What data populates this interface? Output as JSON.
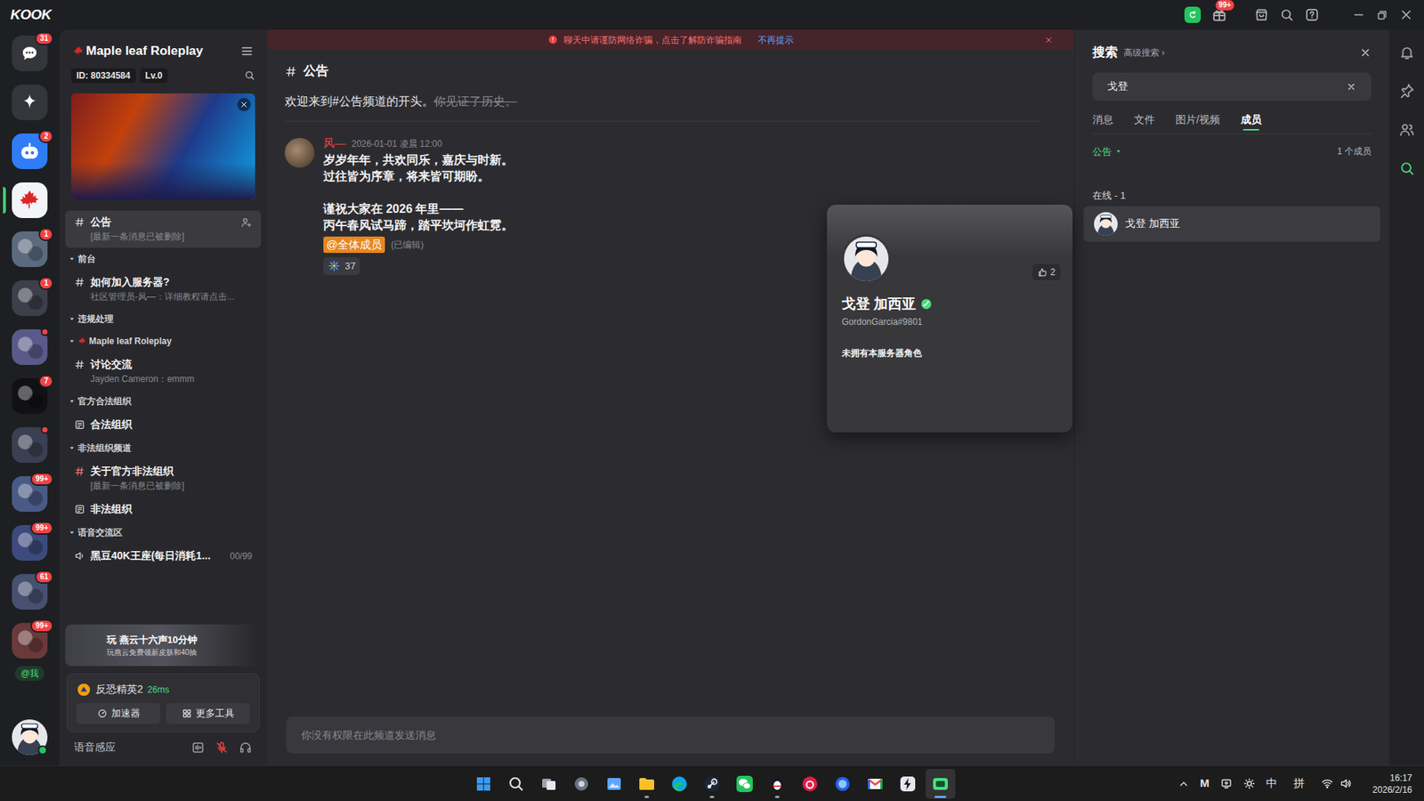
{
  "title_bar": {
    "logo": "KOOK",
    "notification_badge": "99+"
  },
  "server_rail": {
    "items": [
      {
        "kind": "dm",
        "badge": "31",
        "dot": false,
        "selected": false,
        "color": "#35363b"
      },
      {
        "kind": "ai",
        "dot": false,
        "selected": false,
        "color": "#35363b"
      },
      {
        "kind": "bot",
        "badge": "2",
        "dot": false,
        "selected": false,
        "color": "#2f7cf6"
      },
      {
        "kind": "maple",
        "dot": false,
        "selected": true,
        "color": "#f3f4f6"
      },
      {
        "kind": "server",
        "badge": "1",
        "dot": false,
        "selected": false,
        "color": "#5b6b7d"
      },
      {
        "kind": "server",
        "badge": "1",
        "dot": false,
        "selected": false,
        "color": "#3d3f4a"
      },
      {
        "kind": "server",
        "dot": true,
        "selected": false,
        "color": "#5a5a8a"
      },
      {
        "kind": "server",
        "badge": "7",
        "dot": false,
        "selected": false,
        "color": "#111114"
      },
      {
        "kind": "server",
        "dot": true,
        "selected": false,
        "color": "#3b3f52"
      },
      {
        "kind": "server",
        "badge": "99+",
        "dot": false,
        "selected": false,
        "color": "#4a5a86"
      },
      {
        "kind": "server",
        "badge": "99+",
        "dot": false,
        "selected": false,
        "color": "#3d4a7c"
      },
      {
        "kind": "server",
        "badge": "61",
        "dot": false,
        "selected": false,
        "color": "#465070"
      },
      {
        "kind": "server",
        "badge": "99+",
        "dot": false,
        "selected": false,
        "color": "#6a3a3a"
      }
    ],
    "mention": "@我",
    "user": {
      "online": true
    }
  },
  "channel_sidebar": {
    "server_name": "Maple leaf Roleplay",
    "server_id": "ID: 80334584",
    "level": "Lv.0",
    "channels": [
      {
        "kind": "text",
        "name": "公告",
        "subtitle": "[最新一条消息已被删除]",
        "selected": true
      },
      {
        "kind": "category",
        "name": "前台",
        "expanded": true
      },
      {
        "kind": "text",
        "name": "如何加入服务器?",
        "subtitle": "社区管理员-风—：详细教程请点击...",
        "selected": false
      },
      {
        "kind": "category",
        "name": "违规处理",
        "expanded": true
      },
      {
        "kind": "category-leaf",
        "name": "Maple leaf Roleplay",
        "expanded": true
      },
      {
        "kind": "text",
        "name": "讨论交流",
        "subtitle": "Jayden Cameron：emmm",
        "selected": false
      },
      {
        "kind": "category",
        "name": "官方合法组织",
        "expanded": true
      },
      {
        "kind": "board",
        "name": "合法组织",
        "selected": false
      },
      {
        "kind": "category",
        "name": "非法组织频道",
        "expanded": true
      },
      {
        "kind": "restricted",
        "name": "关于官方非法组织",
        "subtitle": "[最新一条消息已被删除]",
        "selected": false
      },
      {
        "kind": "board",
        "name": "非法组织",
        "selected": false
      },
      {
        "kind": "category",
        "name": "语音交流区",
        "expanded": true
      },
      {
        "kind": "voice",
        "name": "黑豆40K王座(每日消耗1...",
        "count": "00/99",
        "selected": false
      }
    ],
    "ad": {
      "title": "玩 燕云十六声10分钟",
      "subtitle": "玩燕云免费领新皮肤和40抽"
    },
    "footer": {
      "game": "反恐精英2",
      "ping": "26ms",
      "buttons": [
        "加速器",
        "更多工具"
      ],
      "voice_mode": "语音感应"
    }
  },
  "main": {
    "banner": {
      "text": "聊天中请谨防网络诈骗，点击了解防诈骗指南",
      "link": "不再提示"
    },
    "channel": {
      "name": "公告"
    },
    "welcome": {
      "text": "欢迎来到#公告频道的开头。",
      "aside": "你见证了历史。"
    },
    "messages": [
      {
        "author": "风—",
        "time": "2026-01-01 凌晨 12:00",
        "paragraphs": [
          [
            "岁岁年年，共欢同乐，嘉庆与时新。",
            "过往皆为序章，将来皆可期盼。"
          ],
          [
            "谨祝大家在 2026 年里——",
            "丙午春风试马蹄，踏平坎坷作虹霓。"
          ]
        ],
        "mention": "@全体成员",
        "edited": "(已编辑)",
        "reactions": [
          {
            "count": "37"
          }
        ]
      }
    ],
    "composer": {
      "placeholder": "你没有权限在此频道发送消息"
    },
    "profile_card": {
      "name": "戈登 加西亚",
      "handle": "GordonGarcia#9801",
      "likes": "2",
      "roles_note": "未拥有本服务器角色"
    }
  },
  "search_panel": {
    "title": "搜索",
    "advanced": "高级搜索 ›",
    "query": "戈登",
    "tabs": [
      {
        "label": "消息",
        "selected": false
      },
      {
        "label": "文件",
        "selected": false
      },
      {
        "label": "图片/视频",
        "selected": false
      },
      {
        "label": "成员",
        "selected": true
      }
    ],
    "filter": "公告",
    "result_count": "1 个成员",
    "section": "在线 - 1",
    "members": [
      {
        "name": "戈登 加西亚",
        "selected": true
      }
    ]
  },
  "right_rail": [
    {
      "kind": "bell",
      "selected": false
    },
    {
      "kind": "pin",
      "selected": false
    },
    {
      "kind": "members",
      "selected": false
    },
    {
      "kind": "search",
      "selected": true
    }
  ],
  "taskbar": {
    "apps": [
      {
        "kind": "start",
        "running": false,
        "selected": false
      },
      {
        "kind": "search",
        "running": false,
        "selected": false
      },
      {
        "kind": "taskview",
        "running": false,
        "selected": false
      },
      {
        "kind": "settings",
        "running": false,
        "selected": false
      },
      {
        "kind": "photos",
        "running": false,
        "selected": false
      },
      {
        "kind": "explorer",
        "running": true,
        "selected": false
      },
      {
        "kind": "edge",
        "running": false,
        "selected": false
      },
      {
        "kind": "steam",
        "running": true,
        "selected": false
      },
      {
        "kind": "wechat",
        "running": false,
        "selected": false
      },
      {
        "kind": "qq",
        "running": true,
        "selected": false
      },
      {
        "kind": "netease",
        "running": false,
        "selected": false
      },
      {
        "kind": "orb",
        "running": false,
        "selected": false
      },
      {
        "kind": "mail",
        "running": false,
        "selected": false
      },
      {
        "kind": "bolt",
        "running": false,
        "selected": false
      },
      {
        "kind": "kook",
        "running": true,
        "selected": true
      }
    ],
    "tray": {
      "app_letter": "M",
      "ime_mode": "中",
      "ime": "拼",
      "time": "16:17",
      "date": "2026/2/16"
    }
  }
}
